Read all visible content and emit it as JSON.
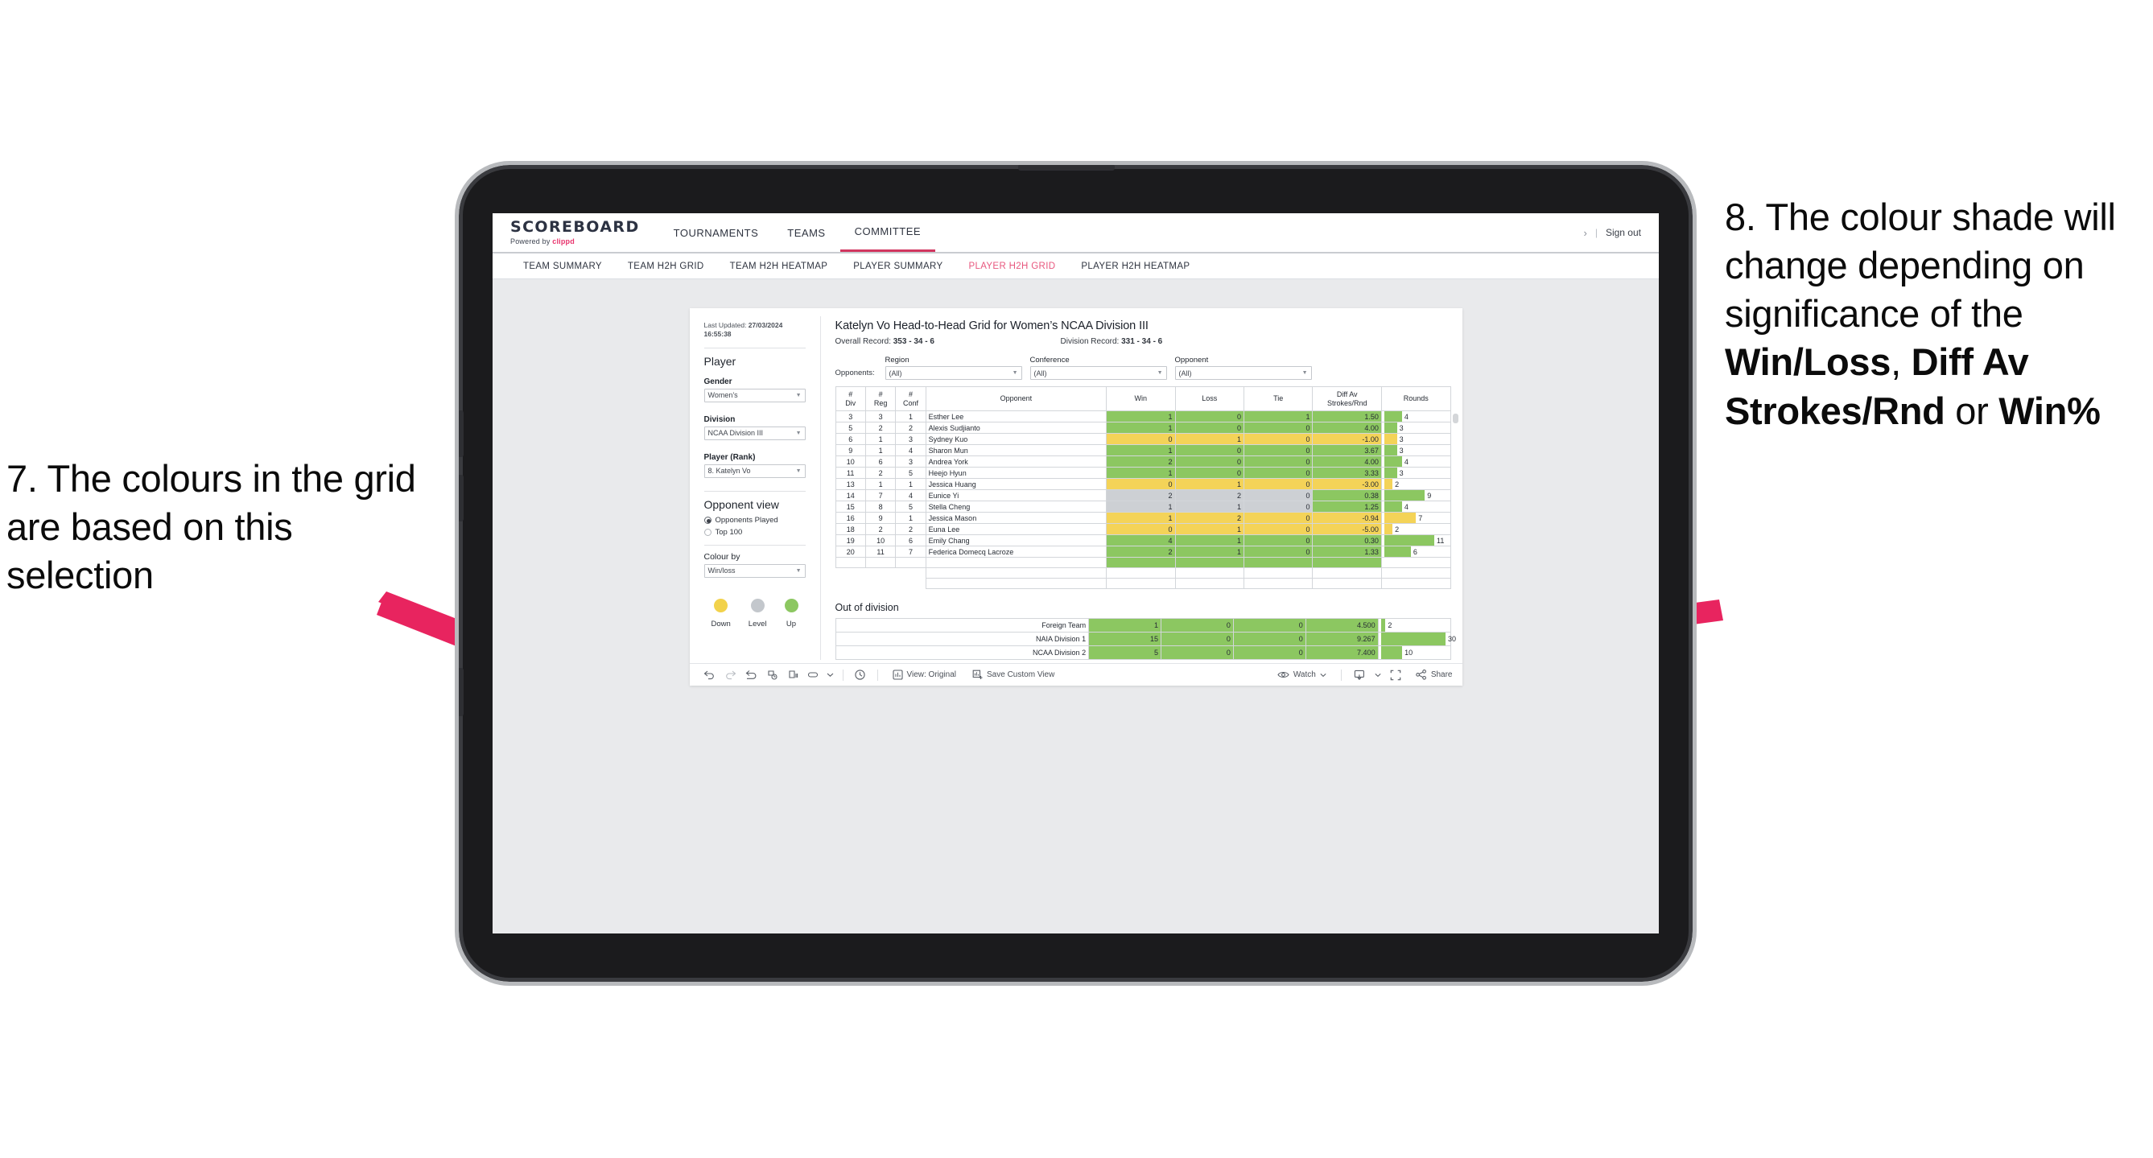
{
  "annotations": {
    "left": {
      "text": "7. The colours in the grid are based on this selection"
    },
    "right": {
      "line1": "8. The colour shade will change depending on significance of the ",
      "bold1": "Win/Loss",
      "mid1": ", ",
      "bold2": "Diff Av Strokes/Rnd",
      "mid2": " or ",
      "bold3": "Win%"
    },
    "arrow_color": "#e8245f"
  },
  "app": {
    "logo": {
      "main": "SCOREBOARD",
      "powered_prefix": "Powered by ",
      "brand": "clippd"
    },
    "topnav": [
      {
        "label": "TOURNAMENTS",
        "active": false
      },
      {
        "label": "TEAMS",
        "active": false
      },
      {
        "label": "COMMITTEE",
        "active": true
      }
    ],
    "right": {
      "chevron": "›",
      "divider": "|",
      "signout": "Sign out"
    },
    "subnav": [
      {
        "label": "TEAM SUMMARY",
        "active": false
      },
      {
        "label": "TEAM H2H GRID",
        "active": false
      },
      {
        "label": "TEAM H2H HEATMAP",
        "active": false
      },
      {
        "label": "PLAYER SUMMARY",
        "active": false
      },
      {
        "label": "PLAYER H2H GRID",
        "active": true
      },
      {
        "label": "PLAYER H2H HEATMAP",
        "active": false
      }
    ],
    "accent": "#e8577e",
    "active_tab_underline": "#d1365f"
  },
  "sidebar": {
    "last_updated_label": "Last Updated: ",
    "last_updated_value": "27/03/2024 16:55:38",
    "section_title": "Player",
    "fields": [
      {
        "label": "Gender",
        "value": "Women’s"
      },
      {
        "label": "Division",
        "value": "NCAA Division III"
      },
      {
        "label": "Player (Rank)",
        "value": "8. Katelyn Vo"
      }
    ],
    "opponent_view": {
      "title": "Opponent view",
      "options": [
        {
          "label": "Opponents Played",
          "selected": true
        },
        {
          "label": "Top 100",
          "selected": false
        }
      ]
    },
    "colour_by": {
      "label": "Colour by",
      "value": "Win/loss"
    },
    "legend": [
      {
        "label": "Down",
        "color": "#f2d24b"
      },
      {
        "label": "Level",
        "color": "#c3c7cc"
      },
      {
        "label": "Up",
        "color": "#8cc761"
      }
    ]
  },
  "main": {
    "title": "Katelyn Vo Head-to-Head Grid for Women’s NCAA Division III",
    "overall_record_label": "Overall Record: ",
    "overall_record_value": "353 -  34 - 6",
    "division_record_label": "Division Record: ",
    "division_record_value": "331 -  34 - 6",
    "opponents_label": "Opponents:",
    "filters": [
      {
        "label": "Region",
        "value": "(All)"
      },
      {
        "label": "Conference",
        "value": "(All)"
      },
      {
        "label": "Opponent",
        "value": "(All)"
      }
    ]
  },
  "chart_data": {
    "type": "table",
    "title": "Katelyn Vo Head-to-Head Grid for Women’s NCAA Division III",
    "columns": [
      "# Div",
      "# Reg",
      "# Conf",
      "Opponent",
      "Win",
      "Loss",
      "Tie",
      "Diff Av Strokes/Rnd",
      "Rounds"
    ],
    "column_headers_two_line": [
      [
        "#",
        "Div"
      ],
      [
        "#",
        "Reg"
      ],
      [
        "#",
        "Conf"
      ],
      [
        "",
        "Opponent"
      ],
      [
        "",
        "Win"
      ],
      [
        "",
        "Loss"
      ],
      [
        "",
        "Tie"
      ],
      [
        "Diff Av",
        "Strokes/Rnd"
      ],
      [
        "",
        "Rounds"
      ]
    ],
    "rows": [
      {
        "div": "3",
        "reg": "3",
        "conf": "1",
        "opponent": "Esther Lee",
        "win": "1",
        "loss": "0",
        "tie": "1",
        "diff": "1.50",
        "rounds": "4",
        "shade": "up",
        "bar_pct": 28
      },
      {
        "div": "5",
        "reg": "2",
        "conf": "2",
        "opponent": "Alexis Sudjianto",
        "win": "1",
        "loss": "0",
        "tie": "0",
        "diff": "4.00",
        "rounds": "3",
        "shade": "up",
        "bar_pct": 20
      },
      {
        "div": "6",
        "reg": "1",
        "conf": "3",
        "opponent": "Sydney Kuo",
        "win": "0",
        "loss": "1",
        "tie": "0",
        "diff": "-1.00",
        "rounds": "3",
        "shade": "down",
        "bar_pct": 20
      },
      {
        "div": "9",
        "reg": "1",
        "conf": "4",
        "opponent": "Sharon Mun",
        "win": "1",
        "loss": "0",
        "tie": "0",
        "diff": "3.67",
        "rounds": "3",
        "shade": "up",
        "bar_pct": 20
      },
      {
        "div": "10",
        "reg": "6",
        "conf": "3",
        "opponent": "Andrea York",
        "win": "2",
        "loss": "0",
        "tie": "0",
        "diff": "4.00",
        "rounds": "4",
        "shade": "up",
        "bar_pct": 28
      },
      {
        "div": "11",
        "reg": "2",
        "conf": "5",
        "opponent": "Heejo Hyun",
        "win": "1",
        "loss": "0",
        "tie": "0",
        "diff": "3.33",
        "rounds": "3",
        "shade": "up",
        "bar_pct": 20
      },
      {
        "div": "13",
        "reg": "1",
        "conf": "1",
        "opponent": "Jessica Huang",
        "win": "0",
        "loss": "1",
        "tie": "0",
        "diff": "-3.00",
        "rounds": "2",
        "shade": "down",
        "bar_pct": 13
      },
      {
        "div": "14",
        "reg": "7",
        "conf": "4",
        "opponent": "Eunice Yi",
        "win": "2",
        "loss": "2",
        "tie": "0",
        "diff": "0.38",
        "rounds": "9",
        "shade": "level",
        "bar_pct": 64,
        "diff_shade": "up"
      },
      {
        "div": "15",
        "reg": "8",
        "conf": "5",
        "opponent": "Stella Cheng",
        "win": "1",
        "loss": "1",
        "tie": "0",
        "diff": "1.25",
        "rounds": "4",
        "shade": "level",
        "bar_pct": 28,
        "diff_shade": "up"
      },
      {
        "div": "16",
        "reg": "9",
        "conf": "1",
        "opponent": "Jessica Mason",
        "win": "1",
        "loss": "2",
        "tie": "0",
        "diff": "-0.94",
        "rounds": "7",
        "shade": "down",
        "bar_pct": 50
      },
      {
        "div": "18",
        "reg": "2",
        "conf": "2",
        "opponent": "Euna Lee",
        "win": "0",
        "loss": "1",
        "tie": "0",
        "diff": "-5.00",
        "rounds": "2",
        "shade": "down",
        "bar_pct": 13
      },
      {
        "div": "19",
        "reg": "10",
        "conf": "6",
        "opponent": "Emily Chang",
        "win": "4",
        "loss": "1",
        "tie": "0",
        "diff": "0.30",
        "rounds": "11",
        "shade": "up",
        "bar_pct": 79
      },
      {
        "div": "20",
        "reg": "11",
        "conf": "7",
        "opponent": "Federica Domecq Lacroze",
        "win": "2",
        "loss": "1",
        "tie": "0",
        "diff": "1.33",
        "rounds": "6",
        "shade": "up",
        "bar_pct": 42
      }
    ],
    "out_of_division": {
      "title": "Out of division",
      "rows": [
        {
          "name": "Foreign Team",
          "win": "1",
          "loss": "0",
          "tie": "0",
          "diff": "4.500",
          "rounds": "2",
          "shade": "up",
          "bar_pct": 7
        },
        {
          "name": "NAIA Division 1",
          "win": "15",
          "loss": "0",
          "tie": "0",
          "diff": "9.267",
          "rounds": "30",
          "shade": "up",
          "bar_pct": 97
        },
        {
          "name": "NCAA Division 2",
          "win": "5",
          "loss": "0",
          "tie": "0",
          "diff": "7.400",
          "rounds": "10",
          "shade": "up",
          "bar_pct": 32
        }
      ]
    },
    "colors": {
      "up": "#8cc761",
      "down": "#f4d358",
      "level": "#cdd0d4",
      "grid": "#d3d6da"
    }
  },
  "toolbar": {
    "icons": [
      "undo-icon",
      "redo-icon",
      "revert-icon",
      "refresh-icon",
      "pause-icon",
      "view-shape-icon",
      "chevron-down-icon",
      "clock-icon"
    ],
    "view_label": "View: Original",
    "save_label": "Save Custom View",
    "watch_label": "Watch",
    "share_label": "Share"
  }
}
